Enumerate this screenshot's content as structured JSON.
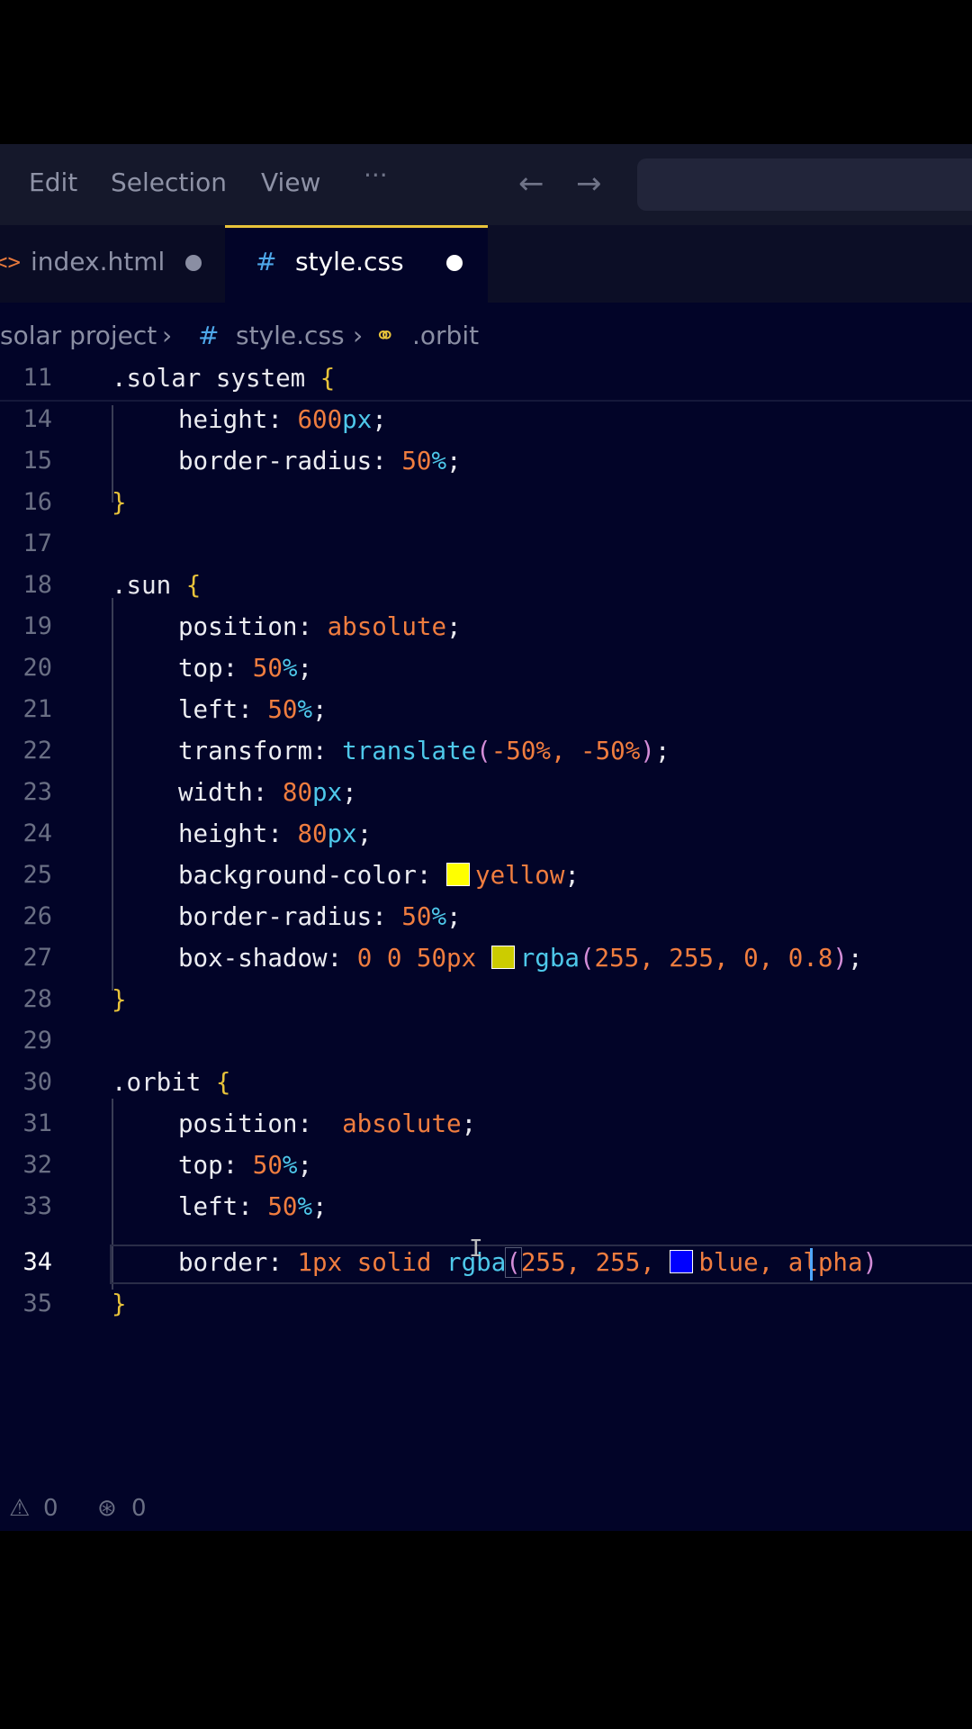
{
  "menu": {
    "items": [
      "Edit",
      "Selection",
      "View",
      "···"
    ]
  },
  "nav": {
    "back": "←",
    "forward": "→"
  },
  "tabs": [
    {
      "icon": "<>",
      "label": "index.html",
      "modified": true
    },
    {
      "icon": "#",
      "label": "style.css",
      "modified": true,
      "active": true
    }
  ],
  "breadcrumb": {
    "folder": "solar project",
    "file_icon": "#",
    "file": "style.css",
    "symbol": ".orbit"
  },
  "editor": {
    "sticky": {
      "number": "11",
      "text": ".solar system {"
    },
    "lines": [
      {
        "n": "14",
        "prop": "height",
        "num": "600",
        "unit": "px"
      },
      {
        "n": "15",
        "prop": "border-radius",
        "num": "50",
        "unit": "%"
      },
      {
        "n": "16",
        "text": "}"
      },
      {
        "n": "17",
        "text": ""
      },
      {
        "n": "18",
        "text": ".sun {"
      },
      {
        "n": "19",
        "prop": "position",
        "value": "absolute"
      },
      {
        "n": "20",
        "prop": "top",
        "num": "50",
        "unit": "%"
      },
      {
        "n": "21",
        "prop": "left",
        "num": "50",
        "unit": "%"
      },
      {
        "n": "22",
        "prop": "transform",
        "fn": "translate",
        "args": "-50%, -50%"
      },
      {
        "n": "23",
        "prop": "width",
        "num": "80",
        "unit": "px"
      },
      {
        "n": "24",
        "prop": "height",
        "num": "80",
        "unit": "px"
      },
      {
        "n": "25",
        "prop": "background-color",
        "value": "yellow",
        "swatch": "#ffff00"
      },
      {
        "n": "26",
        "prop": "border-radius",
        "num": "50",
        "unit": "%"
      },
      {
        "n": "27",
        "prop": "box-shadow",
        "value": "0 0 50px",
        "fn": "rgba",
        "args": "255, 255, 0, 0.8",
        "swatch": "#cccc00"
      },
      {
        "n": "28",
        "text": "}"
      },
      {
        "n": "29",
        "text": ""
      },
      {
        "n": "30",
        "text": ".orbit {"
      },
      {
        "n": "31",
        "prop": "position",
        "value": "absolute"
      },
      {
        "n": "32",
        "prop": "top",
        "num": "50",
        "unit": "%"
      },
      {
        "n": "33",
        "prop": "left",
        "num": "50",
        "unit": "%"
      },
      {
        "n": "34",
        "prop": "border",
        "value": "1px solid",
        "fn": "rgba",
        "args_a": "255, 255,",
        "swatch": "#0000ff",
        "args_b": "blue, alpha",
        "active": true
      },
      {
        "n": "35",
        "text": "}"
      }
    ]
  },
  "status": {
    "warnings": "0",
    "ports": "0"
  },
  "colors": {
    "accent": "#e8c33a",
    "editor_bg": "#020428",
    "cursor": "#4fa7ff"
  }
}
